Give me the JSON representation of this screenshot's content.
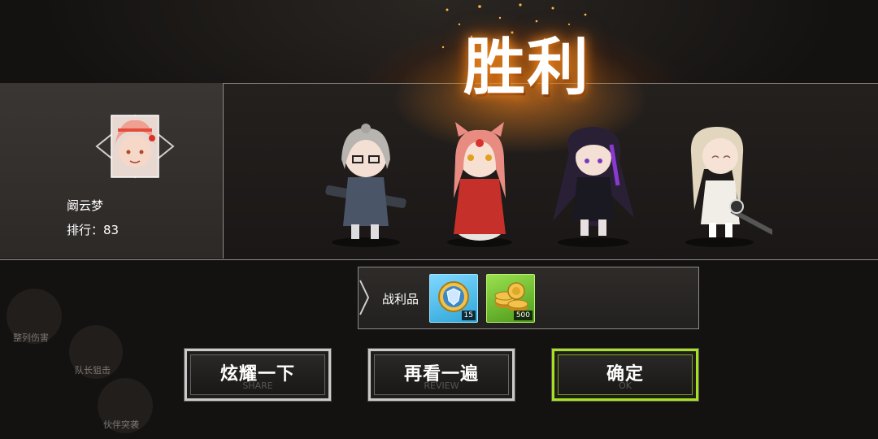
{
  "result": {
    "title": "胜利"
  },
  "player": {
    "name": "阚云梦",
    "rank_label": "排行：83"
  },
  "heroes": [
    {
      "name": "silver-hair-gunner"
    },
    {
      "name": "pink-hair-fox"
    },
    {
      "name": "purple-hair-swordswoman"
    },
    {
      "name": "blonde-hair-swordswoman"
    }
  ],
  "loot": {
    "label": "战利品",
    "items": [
      {
        "icon": "shield-medal-icon",
        "quantity": "15",
        "color": "#2fa6d8"
      },
      {
        "icon": "gold-coins-icon",
        "quantity": "500",
        "color": "#5faa22"
      }
    ]
  },
  "buttons": {
    "share": {
      "label": "炫耀一下",
      "sub": "SHARE"
    },
    "review": {
      "label": "再看一遍",
      "sub": "REVIEW"
    },
    "ok": {
      "label": "确定",
      "sub": "OK"
    }
  },
  "background_menu": [
    {
      "label": "整列伤害"
    },
    {
      "label": "队长狙击"
    },
    {
      "label": "伙伴突袭"
    }
  ],
  "colors": {
    "accent_ok": "#a8e020",
    "glow": "#ff8c14"
  }
}
